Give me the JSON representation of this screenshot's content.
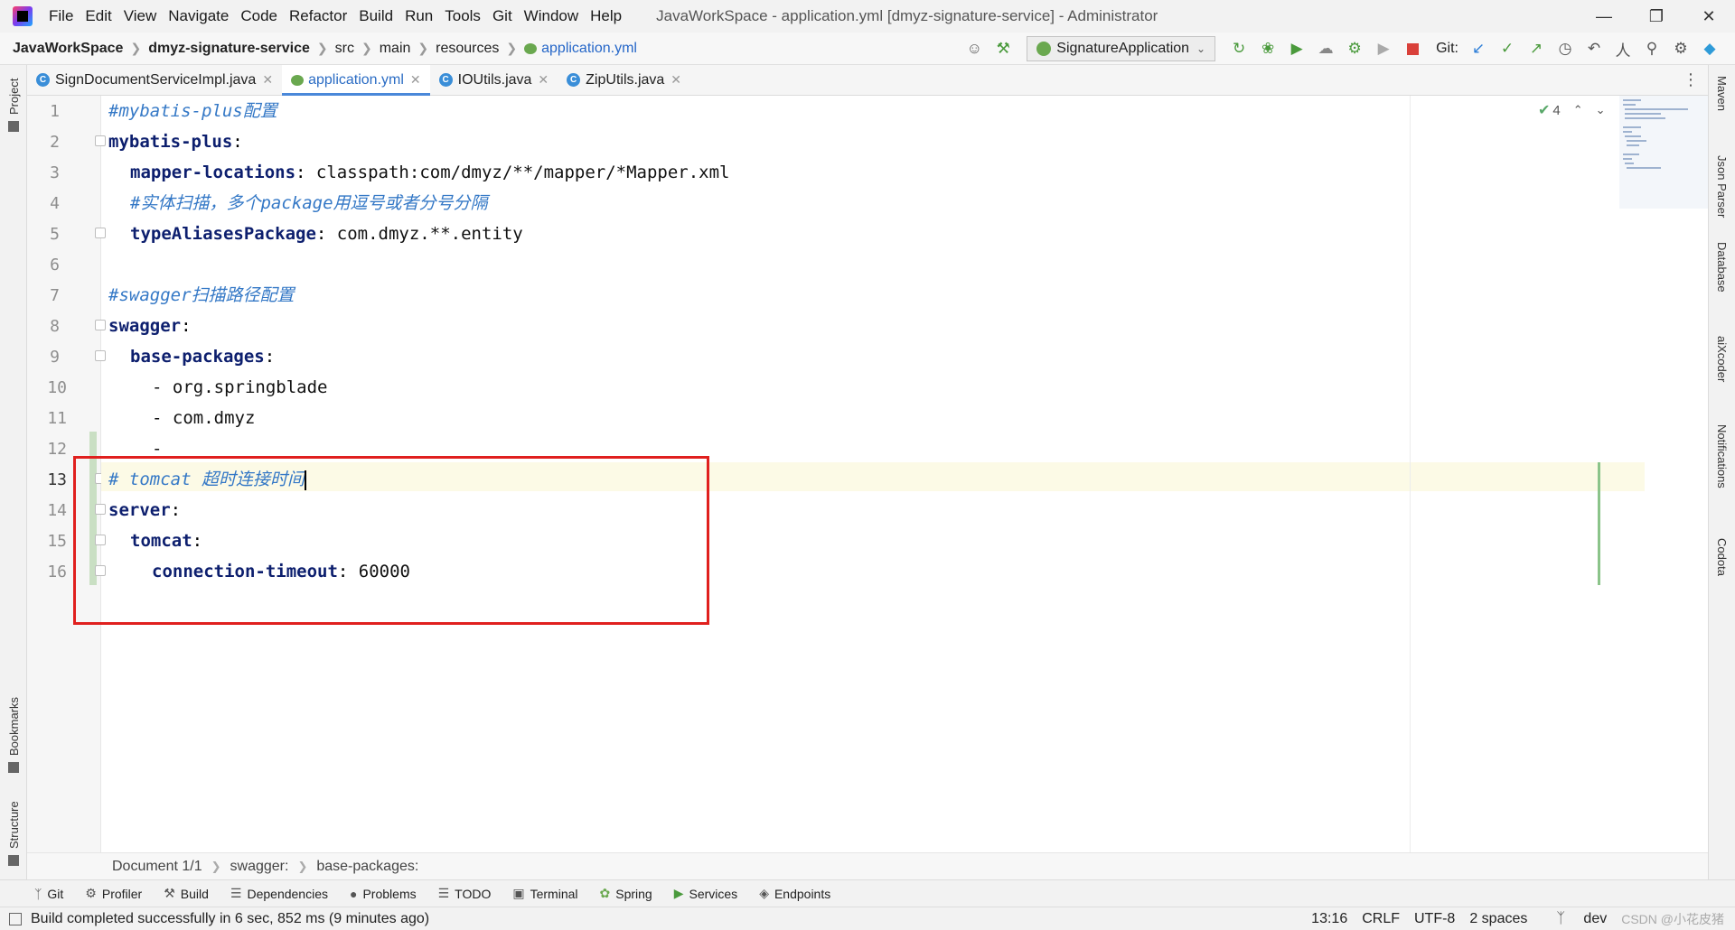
{
  "window": {
    "title": "JavaWorkSpace - application.yml [dmyz-signature-service] - Administrator",
    "menu": [
      "File",
      "Edit",
      "View",
      "Navigate",
      "Code",
      "Refactor",
      "Build",
      "Run",
      "Tools",
      "Git",
      "Window",
      "Help"
    ]
  },
  "breadcrumb": {
    "project": "JavaWorkSpace",
    "module": "dmyz-signature-service",
    "path": [
      "src",
      "main",
      "resources"
    ],
    "file": "application.yml"
  },
  "toolbar": {
    "run_config": "SignatureApplication",
    "git_label": "Git:"
  },
  "tabs": [
    {
      "label": "SignDocumentServiceImpl.java",
      "type": "class",
      "active": false
    },
    {
      "label": "application.yml",
      "type": "yml",
      "active": true
    },
    {
      "label": "IOUtils.java",
      "type": "class",
      "active": false
    },
    {
      "label": "ZipUtils.java",
      "type": "class",
      "active": false
    }
  ],
  "left_tools": {
    "project": "Project",
    "bookmarks": "Bookmarks",
    "structure": "Structure"
  },
  "right_tools": {
    "maven": "Maven",
    "json_parser": "Json Parser",
    "database": "Database",
    "aixcoder": "aiXcoder",
    "notifications": "Notifications",
    "codota": "Codota"
  },
  "editor": {
    "line_numbers": [
      "1",
      "2",
      "3",
      "4",
      "5",
      "6",
      "7",
      "8",
      "9",
      "10",
      "11",
      "12",
      "13",
      "14",
      "15",
      "16"
    ],
    "lines": {
      "l1": {
        "comment": "#mybatis-plus配置"
      },
      "l2": {
        "key": "mybatis-plus",
        "colon": ":"
      },
      "l3": {
        "key": "mapper-locations",
        "colon": ":",
        "value": " classpath:com/dmyz/**/mapper/*Mapper.xml"
      },
      "l4": {
        "comment": "#实体扫描，多个package用逗号或者分号分隔"
      },
      "l5": {
        "key": "typeAliasesPackage",
        "colon": ":",
        "value": " com.dmyz.**.entity"
      },
      "l7": {
        "comment": "#swagger扫描路径配置"
      },
      "l8": {
        "key": "swagger",
        "colon": ":"
      },
      "l9": {
        "key": "base-packages",
        "colon": ":"
      },
      "l10": {
        "value": "- org.springblade"
      },
      "l11": {
        "value": "- com.dmyz"
      },
      "l12": {
        "value": "-"
      },
      "l13": {
        "comment": "# tomcat 超时连接时间"
      },
      "l14": {
        "key": "server",
        "colon": ":"
      },
      "l15": {
        "key": "tomcat",
        "colon": ":"
      },
      "l16": {
        "key": "connection-timeout",
        "colon": ":",
        "value": " 60000"
      }
    },
    "inspection_count": "4",
    "current_line": 13,
    "highlight_color": "#e0201e"
  },
  "editor_breadcrumb": [
    "Document 1/1",
    "swagger:",
    "base-packages:"
  ],
  "tool_windows": [
    "Git",
    "Profiler",
    "Build",
    "Dependencies",
    "Problems",
    "TODO",
    "Terminal",
    "Spring",
    "Services",
    "Endpoints"
  ],
  "status": {
    "message": "Build completed successfully in 6 sec, 852 ms (9 minutes ago)",
    "position": "13:16",
    "line_sep": "CRLF",
    "encoding": "UTF-8",
    "indent": "2 spaces",
    "branch": "dev",
    "watermark": "CSDN @小花皮猪"
  }
}
